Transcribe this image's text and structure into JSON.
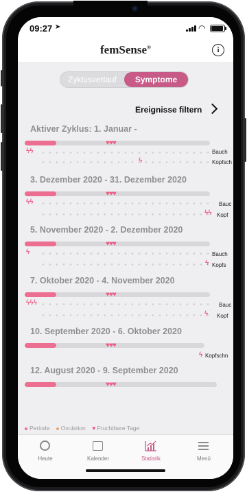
{
  "statusbar": {
    "time": "09:27",
    "location_icon": "location-arrow-icon"
  },
  "header": {
    "brand": "femSense",
    "brand_mark": "®",
    "info_icon": "info-icon"
  },
  "segmented": {
    "option1": "Zyklusverlauf",
    "option2": "Symptome",
    "selected": "Symptome"
  },
  "filter": {
    "label": "Ereignisse filtern"
  },
  "colors": {
    "accent": "#c75a86",
    "period": "#ec6f91",
    "track": "#d8d8db",
    "heart": "#ec5f86"
  },
  "cycles": [
    {
      "title": "Aktiver Zyklus: 1. Januar -",
      "label1": "Bauch",
      "label2": "Kopfsch"
    },
    {
      "title": "3. Dezember 2020 - 31. Dezember 2020",
      "label1": "Bauc",
      "label2": "Kopf"
    },
    {
      "title": "5. November 2020 - 2. Dezember 2020",
      "label1": "Bauch",
      "label2": "Kopfs"
    },
    {
      "title": "7. Oktober 2020 - 4. November 2020",
      "label1": "Bauc",
      "label2": "Kopf"
    },
    {
      "title": "10. September 2020 - 6. Oktober 2020",
      "label1": "Kopfschn"
    },
    {
      "title": "12. August 2020 - 9. September 2020"
    }
  ],
  "legend": {
    "period": "Periode",
    "ovulation": "Ovulation",
    "fertile": "Fruchtbare Tage"
  },
  "tabs": [
    {
      "label": "Heute",
      "icon": "today-ring-icon"
    },
    {
      "label": "Kalender",
      "icon": "calendar-icon"
    },
    {
      "label": "Statistik",
      "icon": "statistics-chart-icon",
      "active": true
    },
    {
      "label": "Menü",
      "icon": "menu-icon"
    }
  ]
}
